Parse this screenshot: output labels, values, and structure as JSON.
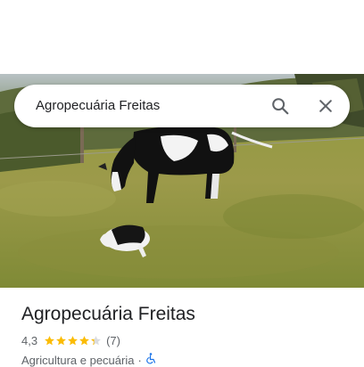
{
  "search": {
    "query": "Agropecuária Freitas"
  },
  "icons": {
    "search": "search-icon",
    "close": "close-icon",
    "accessibility": "wheelchair-icon",
    "photo": "place-photo"
  },
  "place": {
    "name": "Agropecuária Freitas",
    "rating": "4,3",
    "rating_value": 4.3,
    "rating_max": 5,
    "reviews": "(7)",
    "category": "Agricultura e pecuária",
    "separator": "·"
  },
  "colors": {
    "star": "#fbbc04",
    "star_empty": "#dadce0",
    "accessibility": "#1a73e8",
    "text_primary": "#202124",
    "text_secondary": "#5f6368"
  }
}
